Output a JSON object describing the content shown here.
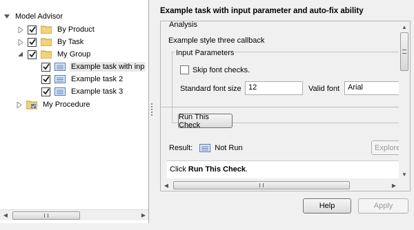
{
  "tree": {
    "root_label": "Model Advisor",
    "items": [
      {
        "label": "By Product",
        "checked": true
      },
      {
        "label": "By Task",
        "checked": true
      },
      {
        "label": "My Group",
        "checked": true
      },
      {
        "label": "Example task with inp",
        "checked": true
      },
      {
        "label": "Example task 2",
        "checked": true
      },
      {
        "label": "Example task 3",
        "checked": true
      },
      {
        "label": "My Procedure"
      }
    ]
  },
  "detail": {
    "title": "Example task with input parameter and auto-fix ability",
    "analysis_label": "Analysis",
    "callback_text": "Example style three callback",
    "input_params_label": "Input Parameters",
    "skip_font_label": "Skip font checks.",
    "standard_font_size_label": "Standard font size",
    "standard_font_size_value": "12",
    "valid_font_label": "Valid font",
    "valid_font_value": "Arial",
    "run_button": "Run This Check",
    "result_label": "Result:",
    "result_status": "Not Run",
    "explore_button": "Explore",
    "message_prefix": "Click ",
    "message_bold": "Run This Check",
    "message_suffix": "."
  },
  "footer": {
    "help_button": "Help",
    "apply_button": "Apply"
  },
  "colors": {
    "folder": "#f2d27a",
    "check": "#1a1a1a",
    "task_icon": "#4f78b8"
  }
}
